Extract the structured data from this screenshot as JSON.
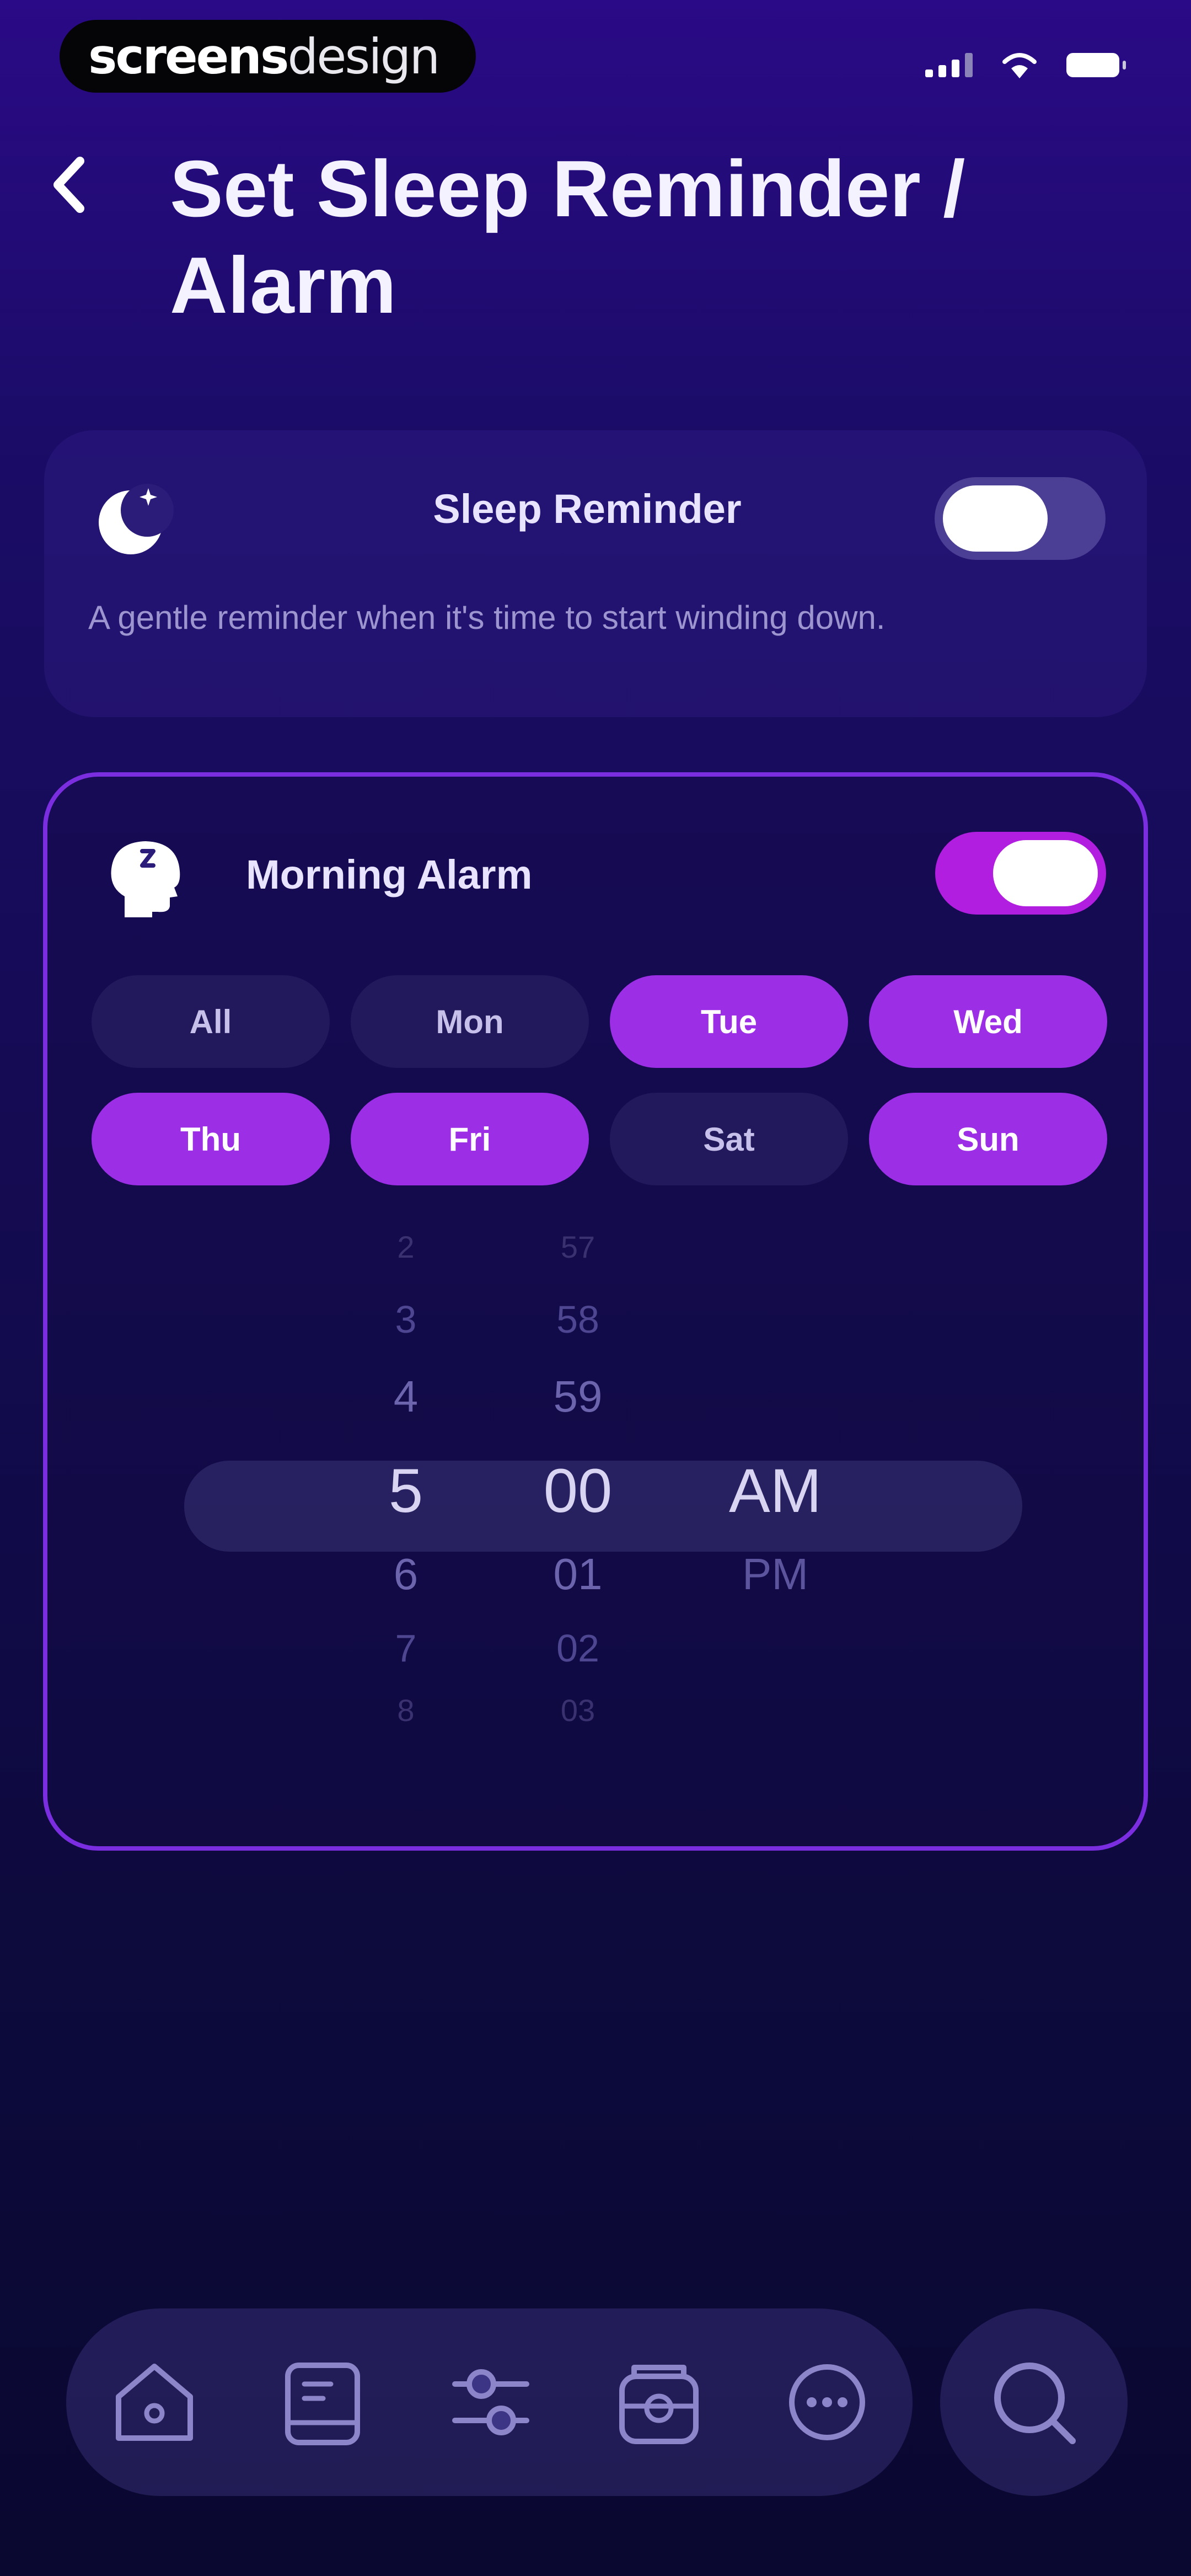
{
  "status_bar": {
    "brand_bold": "screens",
    "brand_light": "design",
    "icons": [
      "signal-icon",
      "wifi-icon",
      "battery-icon"
    ]
  },
  "header": {
    "title": "Set Sleep Reminder / Alarm",
    "back_icon": "chevron-left-icon"
  },
  "sleep_reminder": {
    "icon": "moon-icon",
    "title": "Sleep Reminder",
    "description": "A gentle reminder when it's time to start winding down.",
    "enabled": false
  },
  "morning_alarm": {
    "icon": "sleeping-head-icon",
    "title": "Morning Alarm",
    "enabled": true,
    "days": [
      {
        "label": "All",
        "selected": false
      },
      {
        "label": "Mon",
        "selected": false
      },
      {
        "label": "Tue",
        "selected": true
      },
      {
        "label": "Wed",
        "selected": true
      },
      {
        "label": "Thu",
        "selected": true
      },
      {
        "label": "Fri",
        "selected": true
      },
      {
        "label": "Sat",
        "selected": false
      },
      {
        "label": "Sun",
        "selected": true
      }
    ]
  },
  "time_picker": {
    "hours": [
      "2",
      "3",
      "4",
      "5",
      "6",
      "7",
      "8"
    ],
    "minutes": [
      "57",
      "58",
      "59",
      "00",
      "01",
      "02",
      "03"
    ],
    "periods": [
      "AM",
      "PM"
    ],
    "selected": {
      "hour": "5",
      "minute": "00",
      "period": "AM"
    }
  },
  "tab_bar": {
    "items": [
      "home-icon",
      "journal-icon",
      "sliders-icon",
      "alarm-clock-icon",
      "more-icon"
    ],
    "search_icon": "search-icon"
  },
  "colors": {
    "accent": "#9c2fe6",
    "toggle_on": "#b21ee0",
    "card_border": "#7b2ee0",
    "background_top": "#2a0a86",
    "background_bottom": "#0a0830"
  }
}
